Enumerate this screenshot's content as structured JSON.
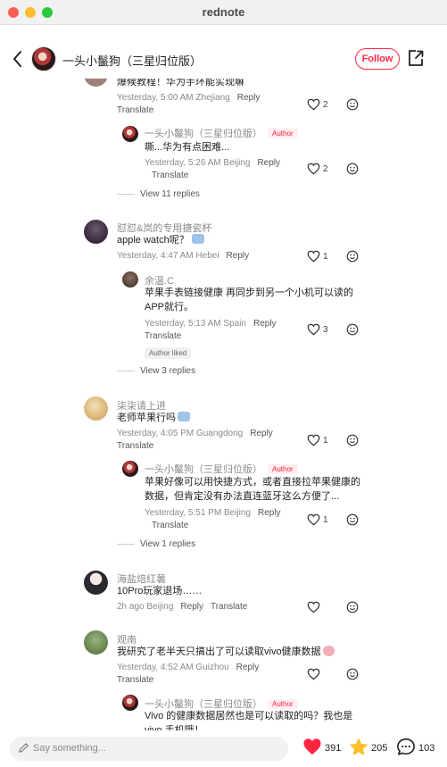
{
  "window": {
    "title": "rednote"
  },
  "header": {
    "author_name": "一头小鬣狗（三星归位版）",
    "follow_label": "Follow"
  },
  "comments": [
    {
      "text": "爆候教程！华为手环能实现嘛",
      "time": "Yesterday, 5:00 AM",
      "location": "Zhejiang",
      "reply_label": "Reply",
      "translate_label": "Translate",
      "likes": "2"
    },
    {
      "user": "一头小鬣狗（三星归位版）",
      "author_tag": "Author",
      "text": "嘶...华为有点困难...",
      "time": "Yesterday, 5:26 AM",
      "location": "Beijing",
      "reply_label": "Reply",
      "translate_label": "Translate",
      "likes": "2"
    },
    {
      "view_replies": "View 11 replies"
    },
    {
      "user": "怼怼&岚的专用搪瓷杯",
      "text": "apple watch呢？",
      "time": "Yesterday, 4:47 AM",
      "location": "Hebei",
      "reply_label": "Reply",
      "likes": "1"
    },
    {
      "user": "余温.C",
      "text_line1": "苹果手表链接健康 再同步到另一个小机可以读的",
      "text_line2": "APP就行。",
      "time": "Yesterday, 5:13 AM",
      "location": "Spain",
      "reply_label": "Reply",
      "translate_label": "Translate",
      "liked_tag": "Author liked",
      "likes": "3"
    },
    {
      "view_replies": "View 3 replies"
    },
    {
      "user": "柒柒请上进",
      "text": "老师苹果行吗",
      "time": "Yesterday, 4:05 PM",
      "location": "Guangdong",
      "reply_label": "Reply",
      "translate_label": "Translate",
      "likes": "1"
    },
    {
      "user": "一头小鬣狗（三星归位版）",
      "author_tag": "Author",
      "text_line1": "苹果好像可以用快捷方式，或者直接拉苹果健康的",
      "text_line2": "数据，但肯定没有办法直连蓝牙这么方便了...",
      "time": "Yesterday, 5:51 PM",
      "location": "Beijing",
      "reply_label": "Reply",
      "translate_label": "Translate",
      "likes": "1"
    },
    {
      "view_replies": "View 1 replies"
    },
    {
      "user": "海盐焙红薯",
      "text": "10Pro玩家退场……",
      "time": "2h ago",
      "location": "Beijing",
      "reply_label": "Reply",
      "translate_label": "Translate"
    },
    {
      "user": "观南",
      "text": "我研究了老半天只搞出了可以读取vivo健康数据",
      "time": "Yesterday, 4:52 AM",
      "location": "Guizhou",
      "reply_label": "Reply",
      "translate_label": "Translate"
    },
    {
      "user": "一头小鬣狗（三星归位版）",
      "author_tag": "Author",
      "text_line1": "Vivo 的健康数据居然也是可以读取的吗？我也是",
      "text_line2": "vivo 手机哦！"
    }
  ],
  "bottom": {
    "placeholder": "Say something...",
    "likes": "391",
    "collects": "205",
    "comments": "103"
  },
  "colors": {
    "accent": "#ff2442",
    "star": "#ffbf2b"
  },
  "icons": [
    "back-chevron-icon",
    "share-icon",
    "heart-icon",
    "emoji-icon",
    "pen-icon",
    "star-icon",
    "comment-bubble-icon"
  ]
}
